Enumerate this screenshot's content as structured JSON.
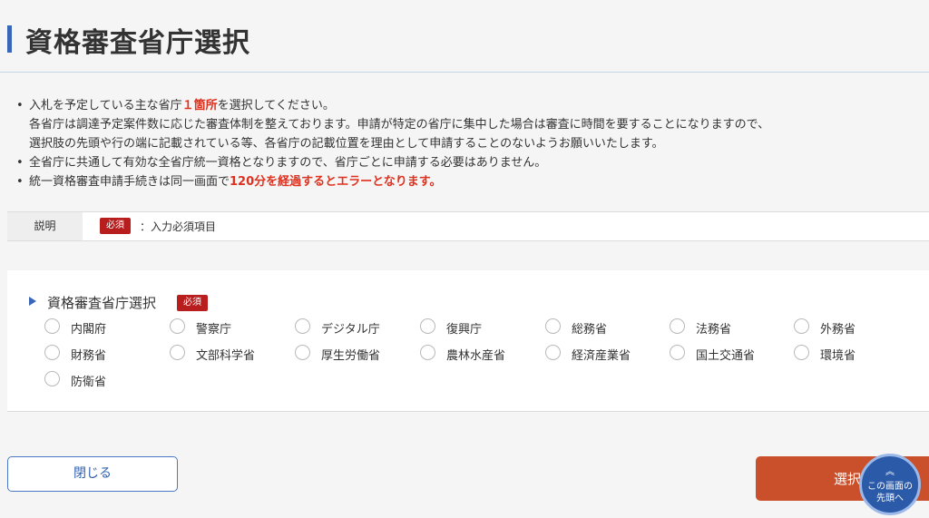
{
  "page": {
    "title": "資格審査省庁選択"
  },
  "notes": {
    "line1_pre": "入札を予定している主な省庁",
    "line1_em": "１箇所",
    "line1_post": "を選択してください。",
    "line2": "各省庁は調達予定案件数に応じた審査体制を整えております。申請が特定の省庁に集中した場合は審査に時間を要することになりますので、",
    "line3": "選択肢の先頭や行の端に記載されている等、各省庁の記載位置を理由として申請することのないようお願いいたします。",
    "line4": "全省庁に共通して有効な全省庁統一資格となりますので、省庁ごとに申請する必要はありません。",
    "line5_pre": "統一資格審査申請手続きは同一画面で",
    "line5_em": "120分を経過するとエラーとなります。"
  },
  "description": {
    "label": "説明",
    "badge": "必須",
    "text": "：入力必須項目"
  },
  "section": {
    "title": "資格審査省庁選択",
    "badge": "必須",
    "options": [
      "内閣府",
      "警察庁",
      "デジタル庁",
      "復興庁",
      "総務省",
      "法務省",
      "外務省",
      "財務省",
      "文部科学省",
      "厚生労働省",
      "農林水産省",
      "経済産業省",
      "国土交通省",
      "環境省",
      "防衛省"
    ]
  },
  "buttons": {
    "close": "閉じる",
    "select": "選択",
    "scroll_top_line1": "この画面の",
    "scroll_top_line2": "先頭へ"
  },
  "colors": {
    "accent": "#3a66b8",
    "required_badge": "#b81e1e",
    "emphasis": "#e0301e",
    "primary_button": "#c9502a"
  },
  "icons": {
    "section_marker": "triangle-right-icon",
    "scroll_top": "chevron-double-up-icon"
  }
}
